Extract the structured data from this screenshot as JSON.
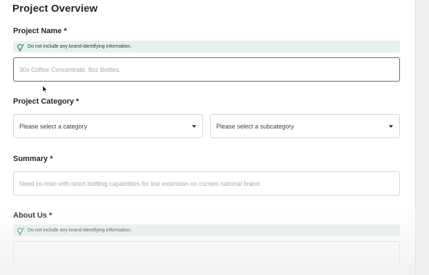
{
  "section": {
    "title": "Project Overview"
  },
  "project_name": {
    "label": "Project Name *",
    "hint": "Do not include any brand-identifying information.",
    "placeholder": "30x Coffee Concentrate, 8oz Bottles."
  },
  "project_category": {
    "label": "Project Category *",
    "category_selected": "Please select a category",
    "subcategory_selected": "Please select a subcategory"
  },
  "summary": {
    "label": "Summary *",
    "placeholder": "Need co-man with retort bottling capabilities for line extension on current national brand."
  },
  "about_us": {
    "label": "About Us *",
    "hint": "Do not include any brand-identifying information.",
    "placeholder": ""
  },
  "icons": {
    "hint_icon": "lightbulb-icon",
    "dropdown_icon": "chevron-down-icon",
    "cursor_icon": "mouse-cursor-icon"
  },
  "colors": {
    "hint_background": "#e4f1ec",
    "hint_icon": "#3c8a63",
    "border": "#cfd6d8",
    "active_border": "#5c6468"
  }
}
